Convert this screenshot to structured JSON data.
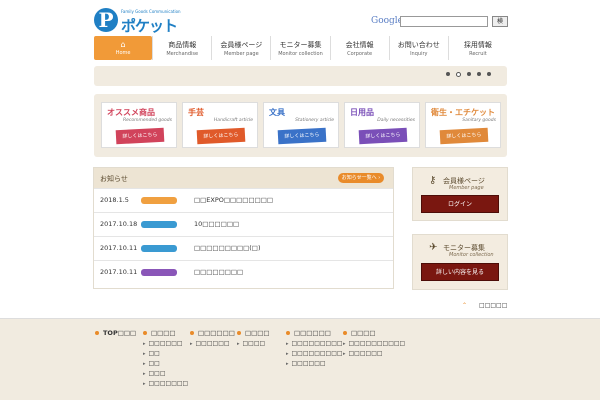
{
  "brand": {
    "circle_letter": "P",
    "tagline": "Family Goods Communication",
    "name": "ポケット"
  },
  "search": {
    "engine_label": "Google",
    "value": "",
    "button_label": "検"
  },
  "nav": [
    {
      "jp": "⌂",
      "en": "Home",
      "active": true
    },
    {
      "jp": "商品情報",
      "en": "Merchandise",
      "active": false
    },
    {
      "jp": "会員様ページ",
      "en": "Member page",
      "active": false
    },
    {
      "jp": "モニター募集",
      "en": "Monitor collection",
      "active": false
    },
    {
      "jp": "会社情報",
      "en": "Corporate",
      "active": false
    },
    {
      "jp": "お問い合わせ",
      "en": "Inquiry",
      "active": false
    },
    {
      "jp": "採用情報",
      "en": "Recruit",
      "active": false
    }
  ],
  "slider": {
    "dot_count": 5,
    "active_dot": 1
  },
  "categories": [
    {
      "title": "オススメ商品",
      "en": "Recommended goods",
      "button": "詳しくはこちら",
      "color": "#d1435b"
    },
    {
      "title": "手芸",
      "en": "Handicraft article",
      "button": "詳しくはこちら",
      "color": "#e05a2a"
    },
    {
      "title": "文具",
      "en": "Stationery article",
      "button": "詳しくはこちら",
      "color": "#3a72c8"
    },
    {
      "title": "日用品",
      "en": "Daily necessities",
      "button": "詳しくはこちら",
      "color": "#7a4fb8"
    },
    {
      "title": "衛生・エチケット",
      "en": "Sanitary goods",
      "button": "詳しくはこちら",
      "color": "#e0893a"
    }
  ],
  "news": {
    "title": "お知らせ",
    "more_label": "お知らせ一覧へ ›",
    "rows": [
      {
        "date": "2018.1.5",
        "badge_color": "#f0a040",
        "text": "□□EXPO□□□□□□□□"
      },
      {
        "date": "2017.10.18",
        "badge_color": "#3a9ad2",
        "text": "10□□□□□□"
      },
      {
        "date": "2017.10.11",
        "badge_color": "#3a9ad2",
        "text": "□□□□□□□□□(□)"
      },
      {
        "date": "2017.10.11",
        "badge_color": "#8a56b8",
        "text": "□□□□□□□□"
      }
    ]
  },
  "member": {
    "icon": "key-icon",
    "title": "会員様ページ",
    "sub": "Member page",
    "button": "ログイン"
  },
  "monitor": {
    "icon": "bird-icon",
    "title": "モニター募集",
    "sub": "Monitor collection",
    "button": "詳しい内容を見る"
  },
  "pagetop": {
    "icon": "up-arrow-icon",
    "label": "□□□□□"
  },
  "footer": {
    "top_label": "TOP□□□",
    "columns": [
      {
        "head": "□□□□",
        "subs": [
          "□□□□□□",
          "□□",
          "□□",
          "□□□",
          "□□□□□□□"
        ]
      },
      {
        "head": "□□□□□□",
        "subs": [
          "□□□□□□"
        ]
      },
      {
        "head": "□□□□",
        "subs": [
          "□□□□"
        ]
      },
      {
        "head": "□□□□□□",
        "subs": [
          "□□□□□□□□□",
          "□□□□□□□□□",
          "□□□□□□"
        ]
      },
      {
        "head": "□□□□",
        "subs": [
          "□□□□□□□□□□",
          "□□□□□□"
        ]
      }
    ]
  }
}
